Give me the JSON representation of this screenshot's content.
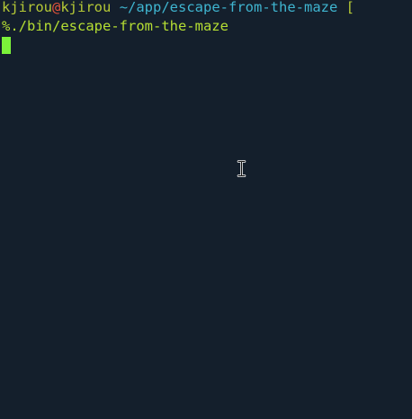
{
  "terminal": {
    "prompt": {
      "user": "kjirou",
      "at": "@",
      "host": "kjirou",
      "path": "~/app/escape-from-the-maze",
      "git_indicator": "["
    },
    "command_line": {
      "prompt_symbol": "%",
      "command": "./bin/escape-from-the-maze"
    }
  },
  "colors": {
    "background": "#141f2c",
    "user": "#b5c936",
    "at": "#e2533b",
    "path": "#3fb5d0",
    "command": "#b5de33",
    "cursor": "#7cf23a"
  },
  "icons": {
    "mouse_pointer": "text-ibeam-cursor-icon"
  }
}
